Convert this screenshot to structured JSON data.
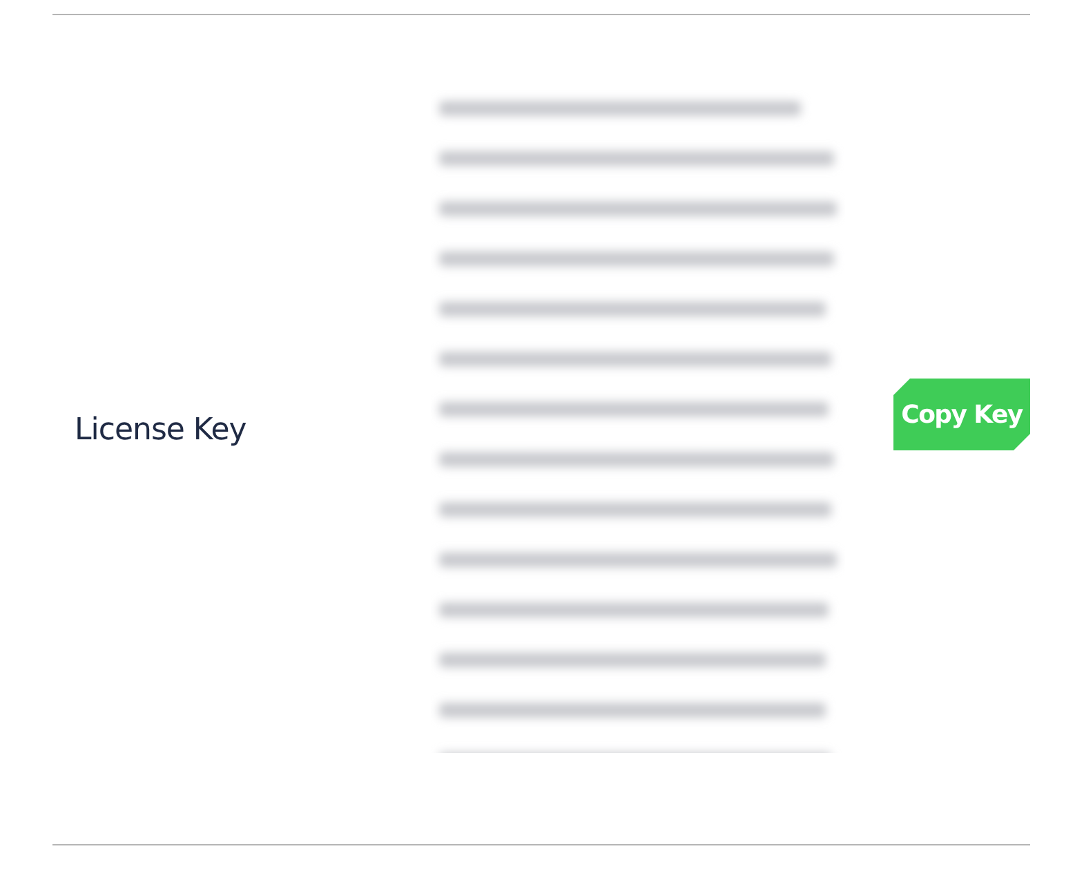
{
  "license_key": {
    "label": "License Key",
    "copy_button": "Copy Key"
  }
}
